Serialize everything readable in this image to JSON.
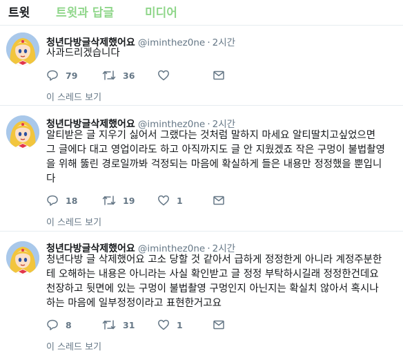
{
  "tabs": [
    {
      "label": "트윗"
    },
    {
      "label": "트윗과 답글"
    },
    {
      "label": "미디어"
    }
  ],
  "colors": {
    "text": "#14171a",
    "muted": "#657786",
    "inactive_tab": "#8fd68a",
    "divider": "#e6ecf0"
  },
  "tweets": [
    {
      "name": "청년다방글삭제했어요",
      "handle": "@iminthez0ne",
      "separator": "·",
      "time": "2시간",
      "lines": [
        "사과드리겠습니다"
      ],
      "replies": "79",
      "retweets": "36",
      "likes": "",
      "thread_label": "이 스레드 보기"
    },
    {
      "name": "청년다방글삭제했어요",
      "handle": "@iminthez0ne",
      "separator": "·",
      "time": "2시간",
      "lines": [
        "알티받은 글 지우기 싫어서 그랬다는 것처럼 말하지 마세요 알티딸치고싶었으면",
        "그 글에다 대고 영업이라도 하고 아직까지도 글 안 지웠겠죠 작은 구멍이 불법촬영",
        "을 위해 뚫린 경로일까봐 걱정되는 마음에 확실하게 들은 내용만 정정했을 뿐입니",
        "다"
      ],
      "replies": "18",
      "retweets": "19",
      "likes": "1",
      "thread_label": "이 스레드 보기"
    },
    {
      "name": "청년다방글삭제했어요",
      "handle": "@iminthez0ne",
      "separator": "·",
      "time": "2시간",
      "lines": [
        "청년다방 글 삭제했어요 고소 당할 것 같아서 급하게 정정한게 아니라 계정주분한",
        "테 오해하는 내용은 아니라는 사실 확인받고 글 정정 부탁하시길래 정정한건데요",
        "천장하고 뒷면에 있는 구멍이 불법촬영 구멍인지 아닌지는 확실치 않아서 혹시나",
        "하는 마음에 일부정정이라고 표현한거고요"
      ],
      "replies": "8",
      "retweets": "31",
      "likes": "1",
      "thread_label": "이 스레드 보기"
    }
  ]
}
